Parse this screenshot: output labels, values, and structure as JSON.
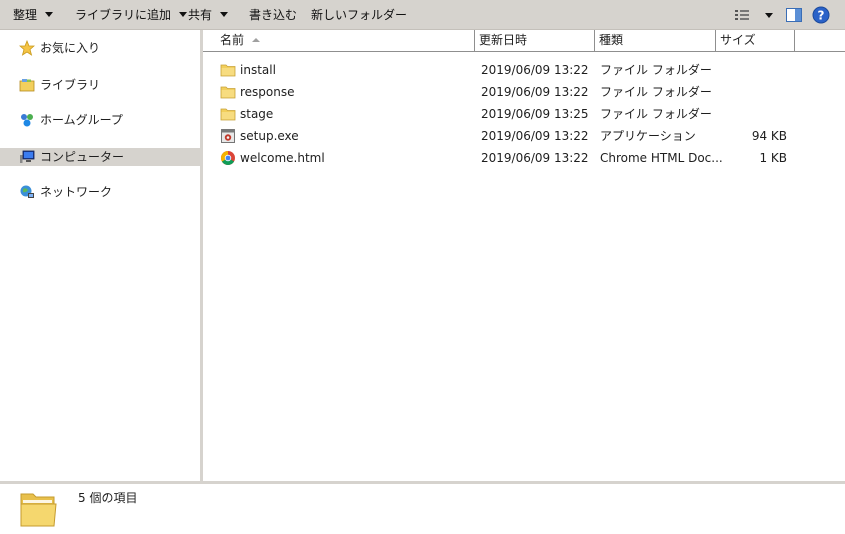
{
  "toolbar": {
    "organize": "整理",
    "add_to_library": "ライブラリに追加",
    "share": "共有",
    "burn": "書き込む",
    "new_folder": "新しいフォルダー"
  },
  "nav": {
    "items": [
      {
        "label": "お気に入り",
        "icon": "star-icon"
      },
      {
        "label": "ライブラリ",
        "icon": "library-icon"
      },
      {
        "label": "ホームグループ",
        "icon": "homegroup-icon"
      },
      {
        "label": "コンピューター",
        "icon": "computer-icon",
        "selected": true
      },
      {
        "label": "ネットワーク",
        "icon": "network-icon"
      }
    ]
  },
  "columns": {
    "name": "名前",
    "date": "更新日時",
    "type": "種類",
    "size": "サイズ"
  },
  "files": [
    {
      "name": "install",
      "date": "2019/06/09 13:22",
      "type": "ファイル フォルダー",
      "size": "",
      "icon": "folder-icon"
    },
    {
      "name": "response",
      "date": "2019/06/09 13:22",
      "type": "ファイル フォルダー",
      "size": "",
      "icon": "folder-icon"
    },
    {
      "name": "stage",
      "date": "2019/06/09 13:25",
      "type": "ファイル フォルダー",
      "size": "",
      "icon": "folder-icon"
    },
    {
      "name": "setup.exe",
      "date": "2019/06/09 13:22",
      "type": "アプリケーション",
      "size": "94 KB",
      "icon": "application-icon"
    },
    {
      "name": "welcome.html",
      "date": "2019/06/09 13:22",
      "type": "Chrome HTML Doc...",
      "size": "1 KB",
      "icon": "chrome-icon"
    }
  ],
  "status": {
    "item_count": "5 個の項目"
  },
  "colors": {
    "chrome_bg": "#d6d3ce",
    "folder_yellow": "#f2cf5c",
    "help_blue": "#2a62c8"
  }
}
